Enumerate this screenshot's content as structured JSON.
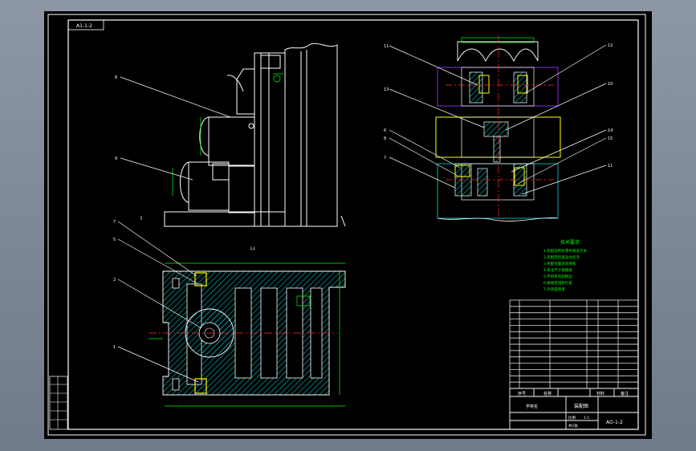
{
  "drawing": {
    "header_tag": "A1-1-2",
    "view_label_left": "I",
    "section_label": "I-I",
    "drawing_number": "AO-1-2",
    "assembly_title": "装配图"
  },
  "balloons": {
    "side_view": [
      "8",
      "9"
    ],
    "section_view": [
      "7",
      "5",
      "2",
      "1"
    ],
    "exploded_view": [
      "11",
      "12",
      "13",
      "10",
      "6",
      "8",
      "7",
      "14",
      "15",
      "11"
    ]
  },
  "tech_notes": {
    "title": "技术要求",
    "lines": [
      "1.装配前所有零件清洗干净",
      "2.装配后检查运动灵活",
      "3.各配合面涂润滑脂",
      "4.未注尺寸按图纸",
      "5.不得有毛刺锐边",
      "6.按规定扭矩拧紧",
      "7.外表面涂漆"
    ]
  },
  "title_block": {
    "header_labels": [
      "序号",
      "名称",
      "材料",
      "备注"
    ],
    "company": "学校名",
    "scale_label": "比例",
    "scale": "1:1",
    "sheet": "共1张"
  },
  "colors": {
    "line": "#ffffff",
    "dim": "#00ff00",
    "hatch": "#00bfbf",
    "centerline": "#ff2a2a",
    "part_yellow": "#ffff00",
    "part_purple": "#8a2be2",
    "text_green": "#00ff00"
  }
}
